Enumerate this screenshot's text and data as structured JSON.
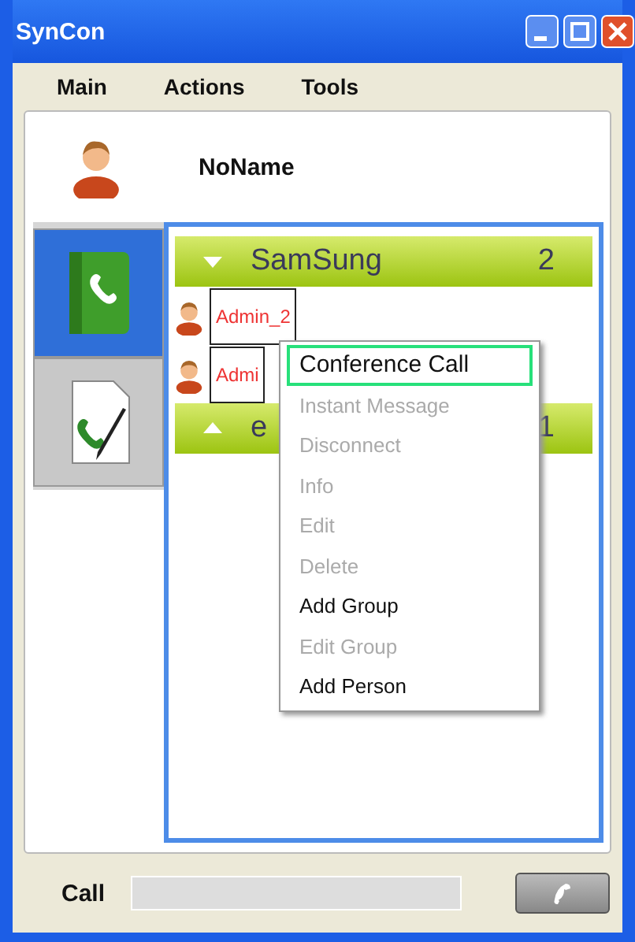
{
  "window": {
    "title": "SynCon"
  },
  "menu": [
    "Main",
    "Actions",
    "Tools"
  ],
  "user": {
    "name": "NoName"
  },
  "side_tabs": [
    {
      "kind": "contacts",
      "selected": true
    },
    {
      "kind": "call-log",
      "selected": false
    }
  ],
  "groups": [
    {
      "name": "SamSung",
      "count": "2",
      "expanded": true,
      "contacts": [
        {
          "name": "Admin_2"
        },
        {
          "name": "Admi"
        }
      ]
    },
    {
      "name": "e",
      "count": "1",
      "expanded": false
    }
  ],
  "context_menu": [
    {
      "label": "Conference Call",
      "disabled": false,
      "selected": true
    },
    {
      "label": "Instant Message",
      "disabled": true,
      "selected": false
    },
    {
      "label": "Disconnect",
      "disabled": true,
      "selected": false
    },
    {
      "label": "Info",
      "disabled": true,
      "selected": false
    },
    {
      "label": "Edit",
      "disabled": true,
      "selected": false
    },
    {
      "label": "Delete",
      "disabled": true,
      "selected": false
    },
    {
      "label": "Add Group",
      "disabled": false,
      "selected": false
    },
    {
      "label": "Edit Group",
      "disabled": true,
      "selected": false
    },
    {
      "label": "Add Person",
      "disabled": false,
      "selected": false
    }
  ],
  "call_bar": {
    "label": "Call"
  }
}
